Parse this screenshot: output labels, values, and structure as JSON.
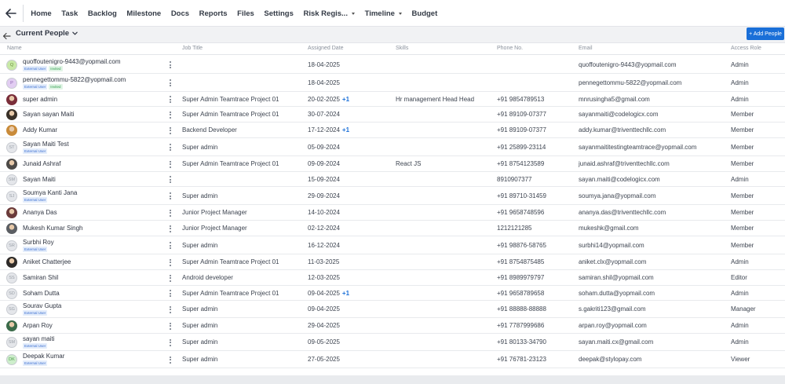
{
  "nav": {
    "items": [
      {
        "label": "Home"
      },
      {
        "label": "Task"
      },
      {
        "label": "Backlog"
      },
      {
        "label": "Milestone"
      },
      {
        "label": "Docs"
      },
      {
        "label": "Reports"
      },
      {
        "label": "Files"
      },
      {
        "label": "Settings"
      },
      {
        "label": "Risk Regis...",
        "dropdown": true
      },
      {
        "label": "Timeline",
        "dropdown": true
      },
      {
        "label": "Budget"
      }
    ]
  },
  "subheader": {
    "view_label": "Current People",
    "add_button": "+ Add People"
  },
  "table": {
    "columns": [
      "Name",
      "Job Title",
      "Assigned Date",
      "Skills",
      "Phone No.",
      "Email",
      "Access Role"
    ],
    "badge_external": "External User",
    "badge_invited": "Invited",
    "rows": [
      {
        "name": "quoffoutenigro-9443@yopmail.com",
        "initials": "Q",
        "avatar_color": "#c8e9a6",
        "avatar_text_color": "#6a8f3c",
        "external": true,
        "invited": true,
        "job": "",
        "date": "18-04-2025",
        "extra": "",
        "skills": "",
        "phone": "",
        "email": "quoffoutenigro-9443@yopmail.com",
        "role": "Admin"
      },
      {
        "name": "pennegettommu-5822@yopmail.com",
        "initials": "P",
        "avatar_color": "#e2cdf2",
        "avatar_text_color": "#8a5fae",
        "external": true,
        "invited": true,
        "job": "",
        "date": "18-04-2025",
        "extra": "",
        "skills": "",
        "phone": "",
        "email": "pennegettommu-5822@yopmail.com",
        "role": "Admin"
      },
      {
        "name": "super admin",
        "photo_color": "#7a2e3a",
        "external": false,
        "invited": false,
        "job": "Super Admin Teamtrace Project 01",
        "date": "20-02-2025",
        "extra": "+1",
        "skills": "Hr management Head Head",
        "phone": "+91 9854789513",
        "email": "mnrusingha5@gmail.com",
        "role": "Admin"
      },
      {
        "name": "Sayan sayan Maiti",
        "photo_color": "#3a3128",
        "external": false,
        "invited": false,
        "job": "Super Admin Teamtrace Project 01",
        "date": "30-07-2024",
        "extra": "",
        "skills": "",
        "phone": "+91 89109-07377",
        "email": "sayanmaiti@codelogicx.com",
        "role": "Member"
      },
      {
        "name": "Addy Kumar",
        "photo_color": "#c98b3a",
        "external": false,
        "invited": false,
        "job": "Backend Developer",
        "date": "17-12-2024",
        "extra": "+1",
        "skills": "",
        "phone": "+91 89109-07377",
        "email": "addy.kumar@triventtechllc.com",
        "role": "Member"
      },
      {
        "name": "Sayan Maiti Test",
        "initials": "ST",
        "avatar_color": "#e4e6ea",
        "avatar_text_color": "#9aa0a8",
        "external": true,
        "invited": false,
        "job": "Super admin",
        "date": "05-09-2024",
        "extra": "",
        "skills": "",
        "phone": "+91 25899-23114",
        "email": "sayanmaititestingteamtrace@yopmail.com",
        "role": "Member"
      },
      {
        "name": "Junaid Ashraf",
        "photo_color": "#4d4a47",
        "external": false,
        "invited": false,
        "job": "Super Admin Teamtrace Project 01",
        "date": "09-09-2024",
        "extra": "",
        "skills": "React JS",
        "phone": "+91 8754123589",
        "email": "junaid.ashraf@triventtechllc.com",
        "role": "Member"
      },
      {
        "name": "Sayan Maiti",
        "initials": "SM",
        "avatar_color": "#e4e6ea",
        "avatar_text_color": "#9aa0a8",
        "external": false,
        "invited": false,
        "job": "",
        "date": "15-09-2024",
        "extra": "",
        "skills": "",
        "phone": "8910907377",
        "email": "sayan.maiti@codelogicx.com",
        "role": "Admin"
      },
      {
        "name": "Soumya Kanti Jana",
        "initials": "SJ",
        "avatar_color": "#e4e6ea",
        "avatar_text_color": "#9aa0a8",
        "external": true,
        "invited": false,
        "job": "Super admin",
        "date": "29-09-2024",
        "extra": "",
        "skills": "",
        "phone": "+91 89710-31459",
        "email": "soumya.jana@yopmail.com",
        "role": "Member"
      },
      {
        "name": "Ananya Das",
        "photo_color": "#6b3b3b",
        "external": false,
        "invited": false,
        "job": "Junior Project Manager",
        "date": "14-10-2024",
        "extra": "",
        "skills": "",
        "phone": "+91 9658748596",
        "email": "ananya.das@triventtechllc.com",
        "role": "Member"
      },
      {
        "name": "Mukesh Kumar Singh",
        "photo_color": "#5b5e63",
        "external": false,
        "invited": false,
        "job": "Junior Project Manager",
        "date": "02-12-2024",
        "extra": "",
        "skills": "",
        "phone": "1212121285",
        "email": "mukeshk@gmail.com",
        "role": "Member"
      },
      {
        "name": "Surbhi Roy",
        "initials": "SR",
        "avatar_color": "#e4e6ea",
        "avatar_text_color": "#9aa0a8",
        "external": true,
        "invited": false,
        "job": "Super admin",
        "date": "16-12-2024",
        "extra": "",
        "skills": "",
        "phone": "+91 98876-58765",
        "email": "surbhi14@yopmail.com",
        "role": "Member"
      },
      {
        "name": "Aniket Chatterjee",
        "photo_color": "#2e2b29",
        "external": false,
        "invited": false,
        "job": "Super Admin Teamtrace Project 01",
        "date": "11-03-2025",
        "extra": "",
        "skills": "",
        "phone": "+91 8754875485",
        "email": "aniket.clx@yopmail.com",
        "role": "Admin"
      },
      {
        "name": "Samiran Shil",
        "initials": "SS",
        "avatar_color": "#e4e6ea",
        "avatar_text_color": "#9aa0a8",
        "external": false,
        "invited": false,
        "job": "Android developer",
        "date": "12-03-2025",
        "extra": "",
        "skills": "",
        "phone": "+91 8989979797",
        "email": "samiran.shil@yopmail.com",
        "role": "Editor"
      },
      {
        "name": "Soham Dutta",
        "initials": "SD",
        "avatar_color": "#e4e6ea",
        "avatar_text_color": "#9aa0a8",
        "external": false,
        "invited": false,
        "job": "Super Admin Teamtrace Project 01",
        "date": "09-04-2025",
        "extra": "+1",
        "skills": "",
        "phone": "+91 9658789658",
        "email": "soham.dutta@yopmail.com",
        "role": "Admin"
      },
      {
        "name": "Sourav Gupta",
        "initials": "SG",
        "avatar_color": "#e4e6ea",
        "avatar_text_color": "#9aa0a8",
        "external": true,
        "invited": false,
        "job": "Super admin",
        "date": "09-04-2025",
        "extra": "",
        "skills": "",
        "phone": "+91 88888-88888",
        "email": "s.gakriti123@gmail.com",
        "role": "Manager"
      },
      {
        "name": "Arpan Roy",
        "photo_color": "#3b6b4a",
        "external": false,
        "invited": false,
        "job": "Super admin",
        "date": "29-04-2025",
        "extra": "",
        "skills": "",
        "phone": "+91 7787999686",
        "email": "arpan.roy@yopmail.com",
        "role": "Admin"
      },
      {
        "name": "sayan maiti",
        "initials": "SM",
        "avatar_color": "#e4e6ea",
        "avatar_text_color": "#9aa0a8",
        "external": true,
        "invited": false,
        "job": "Super admin",
        "date": "09-05-2025",
        "extra": "",
        "skills": "",
        "phone": "+91 80133-34790",
        "email": "sayan.maiti.cx@gmail.com",
        "role": "Admin"
      },
      {
        "name": "Deepak Kumar",
        "initials": "DK",
        "avatar_color": "#cdeecb",
        "avatar_text_color": "#4f9a4c",
        "external": true,
        "invited": false,
        "job": "Super admin",
        "date": "27-05-2025",
        "extra": "",
        "skills": "",
        "phone": "+91 76781-23123",
        "email": "deepak@stylopay.com",
        "role": "Viewer"
      }
    ]
  }
}
